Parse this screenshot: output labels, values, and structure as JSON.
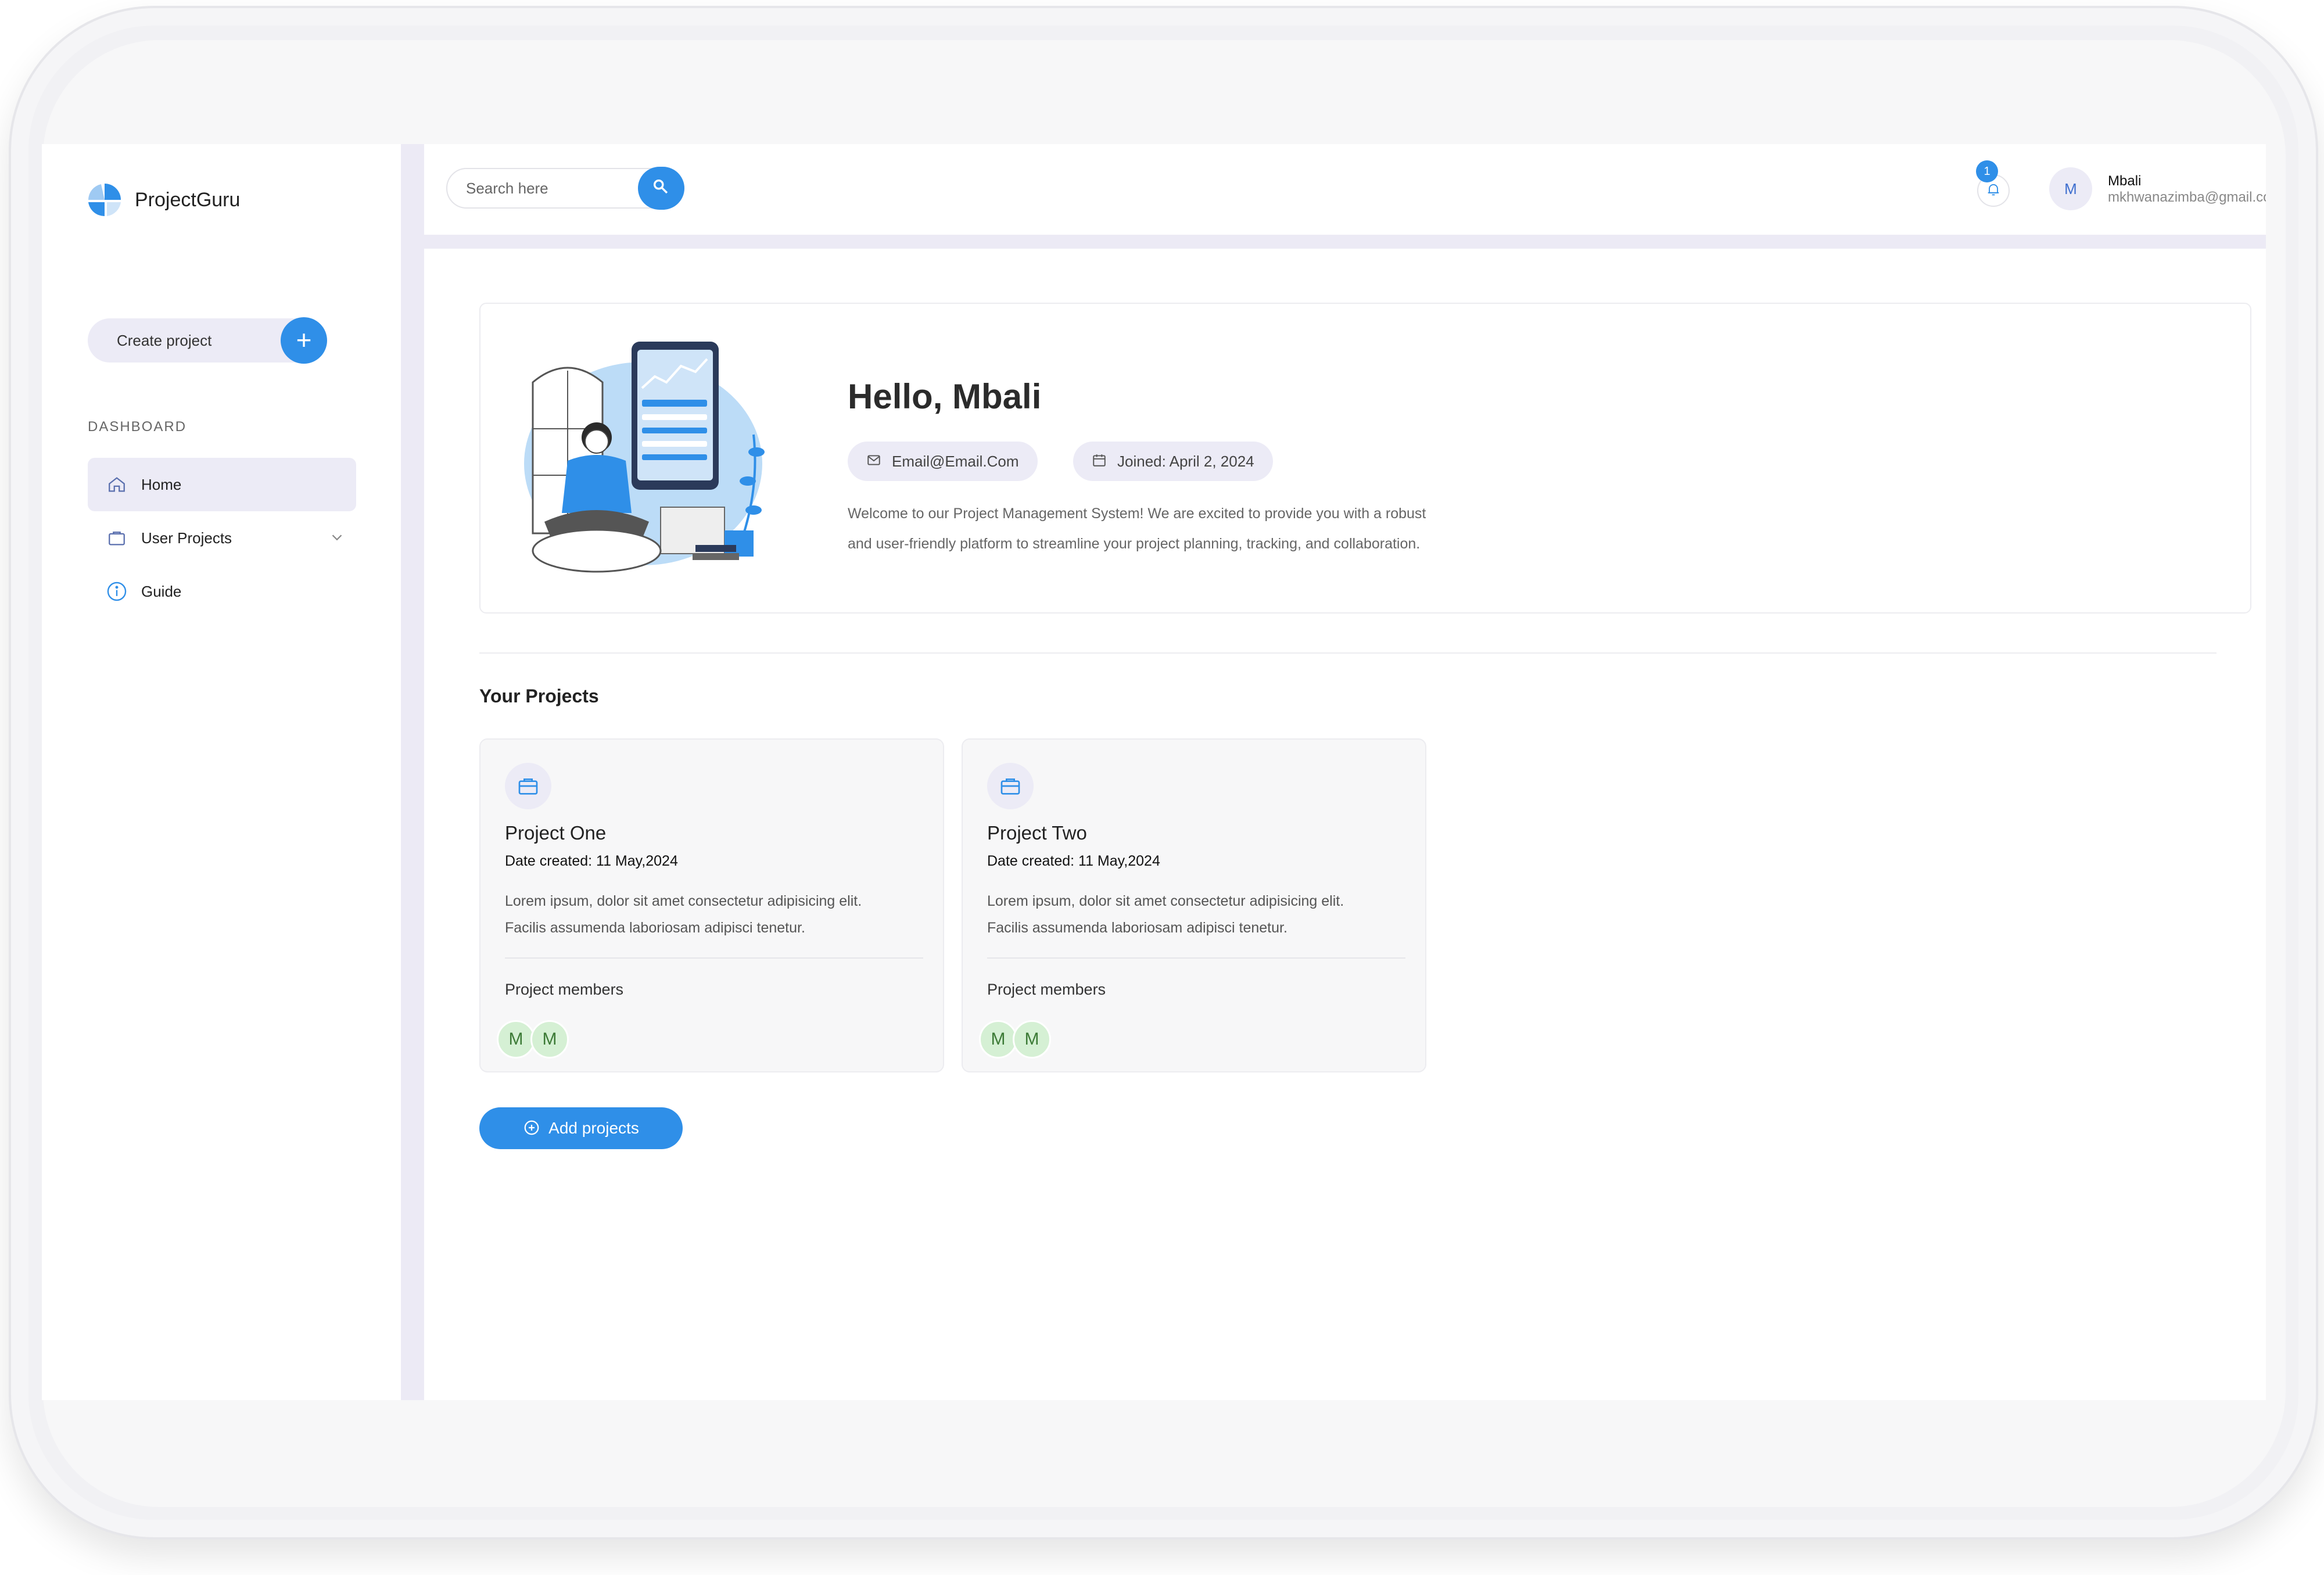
{
  "app": {
    "name": "ProjectGuru"
  },
  "sidebar": {
    "create_label": "Create project",
    "section_label": "DASHBOARD",
    "items": [
      {
        "label": "Home"
      },
      {
        "label": "User Projects"
      },
      {
        "label": "Guide"
      }
    ]
  },
  "topbar": {
    "search_placeholder": "Search here",
    "notification_count": "1",
    "user_initial": "M",
    "user_name": "Mbali",
    "user_email": "mkhwanazimba@gmail.com"
  },
  "hero": {
    "greeting": "Hello, Mbali",
    "email": "Email@Email.Com",
    "joined": "Joined: April 2, 2024",
    "welcome_line1": "Welcome to our Project Management System! We are excited to provide you with a robust",
    "welcome_line2": "and user-friendly platform to streamline your project planning, tracking, and collaboration."
  },
  "projects": {
    "heading": "Your Projects",
    "members_label": "Project members",
    "items": [
      {
        "title": "Project One",
        "date": "Date created: 11 May,2024",
        "desc_line1": "Lorem ipsum, dolor sit amet consectetur adipisicing elit.",
        "desc_line2": "Facilis assumenda laboriosam adipisci tenetur.",
        "members": [
          "M",
          "M"
        ]
      },
      {
        "title": "Project Two",
        "date": "Date created: 11 May,2024",
        "desc_line1": "Lorem ipsum, dolor sit amet consectetur adipisicing elit.",
        "desc_line2": "Facilis assumenda laboriosam adipisci tenetur.",
        "members": [
          "M",
          "M"
        ]
      }
    ],
    "add_label": "Add projects"
  },
  "colors": {
    "accent": "#2f8fe8",
    "pill_bg": "#ecebf6",
    "member_bg": "#d5f0d4"
  }
}
